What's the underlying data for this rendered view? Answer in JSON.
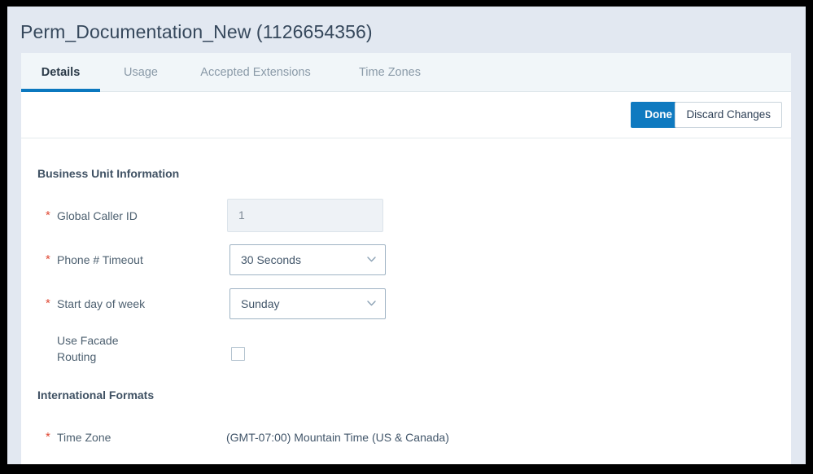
{
  "window": {
    "title": "Perm_Documentation_New (1126654356)"
  },
  "tabs": [
    {
      "label": "Details",
      "active": true
    },
    {
      "label": "Usage",
      "active": false
    },
    {
      "label": "Accepted Extensions",
      "active": false
    },
    {
      "label": "Time Zones",
      "active": false
    }
  ],
  "toolbar": {
    "done_label": "Done",
    "discard_label": "Discard Changes"
  },
  "sections": {
    "business_unit": {
      "heading": "Business Unit Information",
      "fields": {
        "global_caller_id": {
          "label": "Global Caller ID",
          "required_marker": "*",
          "value": "1"
        },
        "phone_timeout": {
          "label": "Phone # Timeout",
          "required_marker": "*",
          "value": "30 Seconds",
          "icon": "chevron-down-icon"
        },
        "start_day_of_week": {
          "label": "Start day of week",
          "required_marker": "*",
          "value": "Sunday",
          "icon": "chevron-down-icon"
        },
        "use_facade_routing": {
          "label": "Use Facade Routing",
          "checked": false
        }
      }
    },
    "international_formats": {
      "heading": "International Formats",
      "fields": {
        "time_zone": {
          "label": "Time Zone",
          "required_marker": "*",
          "value": "(GMT-07:00) Mountain Time (US & Canada)"
        }
      }
    }
  },
  "colors": {
    "accent_blue": "#0f7ac0",
    "tab_underline": "#0b78bf",
    "required_star": "#e04b37",
    "page_background": "#e2e8f1",
    "tab_strip_background": "#f1f6f9",
    "panel_background": "#ffffff",
    "label_text": "#4d6070",
    "heading_text": "#3f5163"
  }
}
